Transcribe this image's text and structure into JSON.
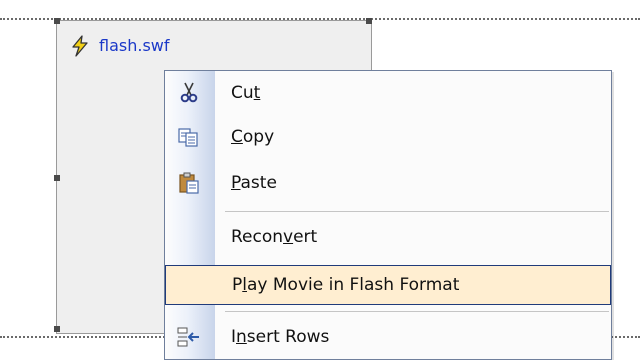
{
  "object": {
    "file_name": "flash.swf",
    "icon": "flash-icon"
  },
  "menu": {
    "items": [
      {
        "label": "Cut",
        "icon": "scissors-icon",
        "mnemonic": "t"
      },
      {
        "label": "Copy",
        "icon": "copy-icon",
        "mnemonic": "C"
      },
      {
        "label": "Paste",
        "icon": "paste-icon",
        "mnemonic": "P"
      },
      {
        "label": "Reconvert",
        "icon": null,
        "mnemonic": "v"
      },
      {
        "label": "Play Movie in Flash Format",
        "icon": null,
        "mnemonic": "l",
        "highlighted": true
      },
      {
        "label": "Insert Rows",
        "icon": "insert-rows-icon",
        "mnemonic": "n"
      }
    ]
  },
  "colors": {
    "highlight_bg": "#ffeed1",
    "highlight_border": "#203b7a",
    "link_blue": "#1a38c8",
    "menu_border": "#6f7f9c"
  }
}
